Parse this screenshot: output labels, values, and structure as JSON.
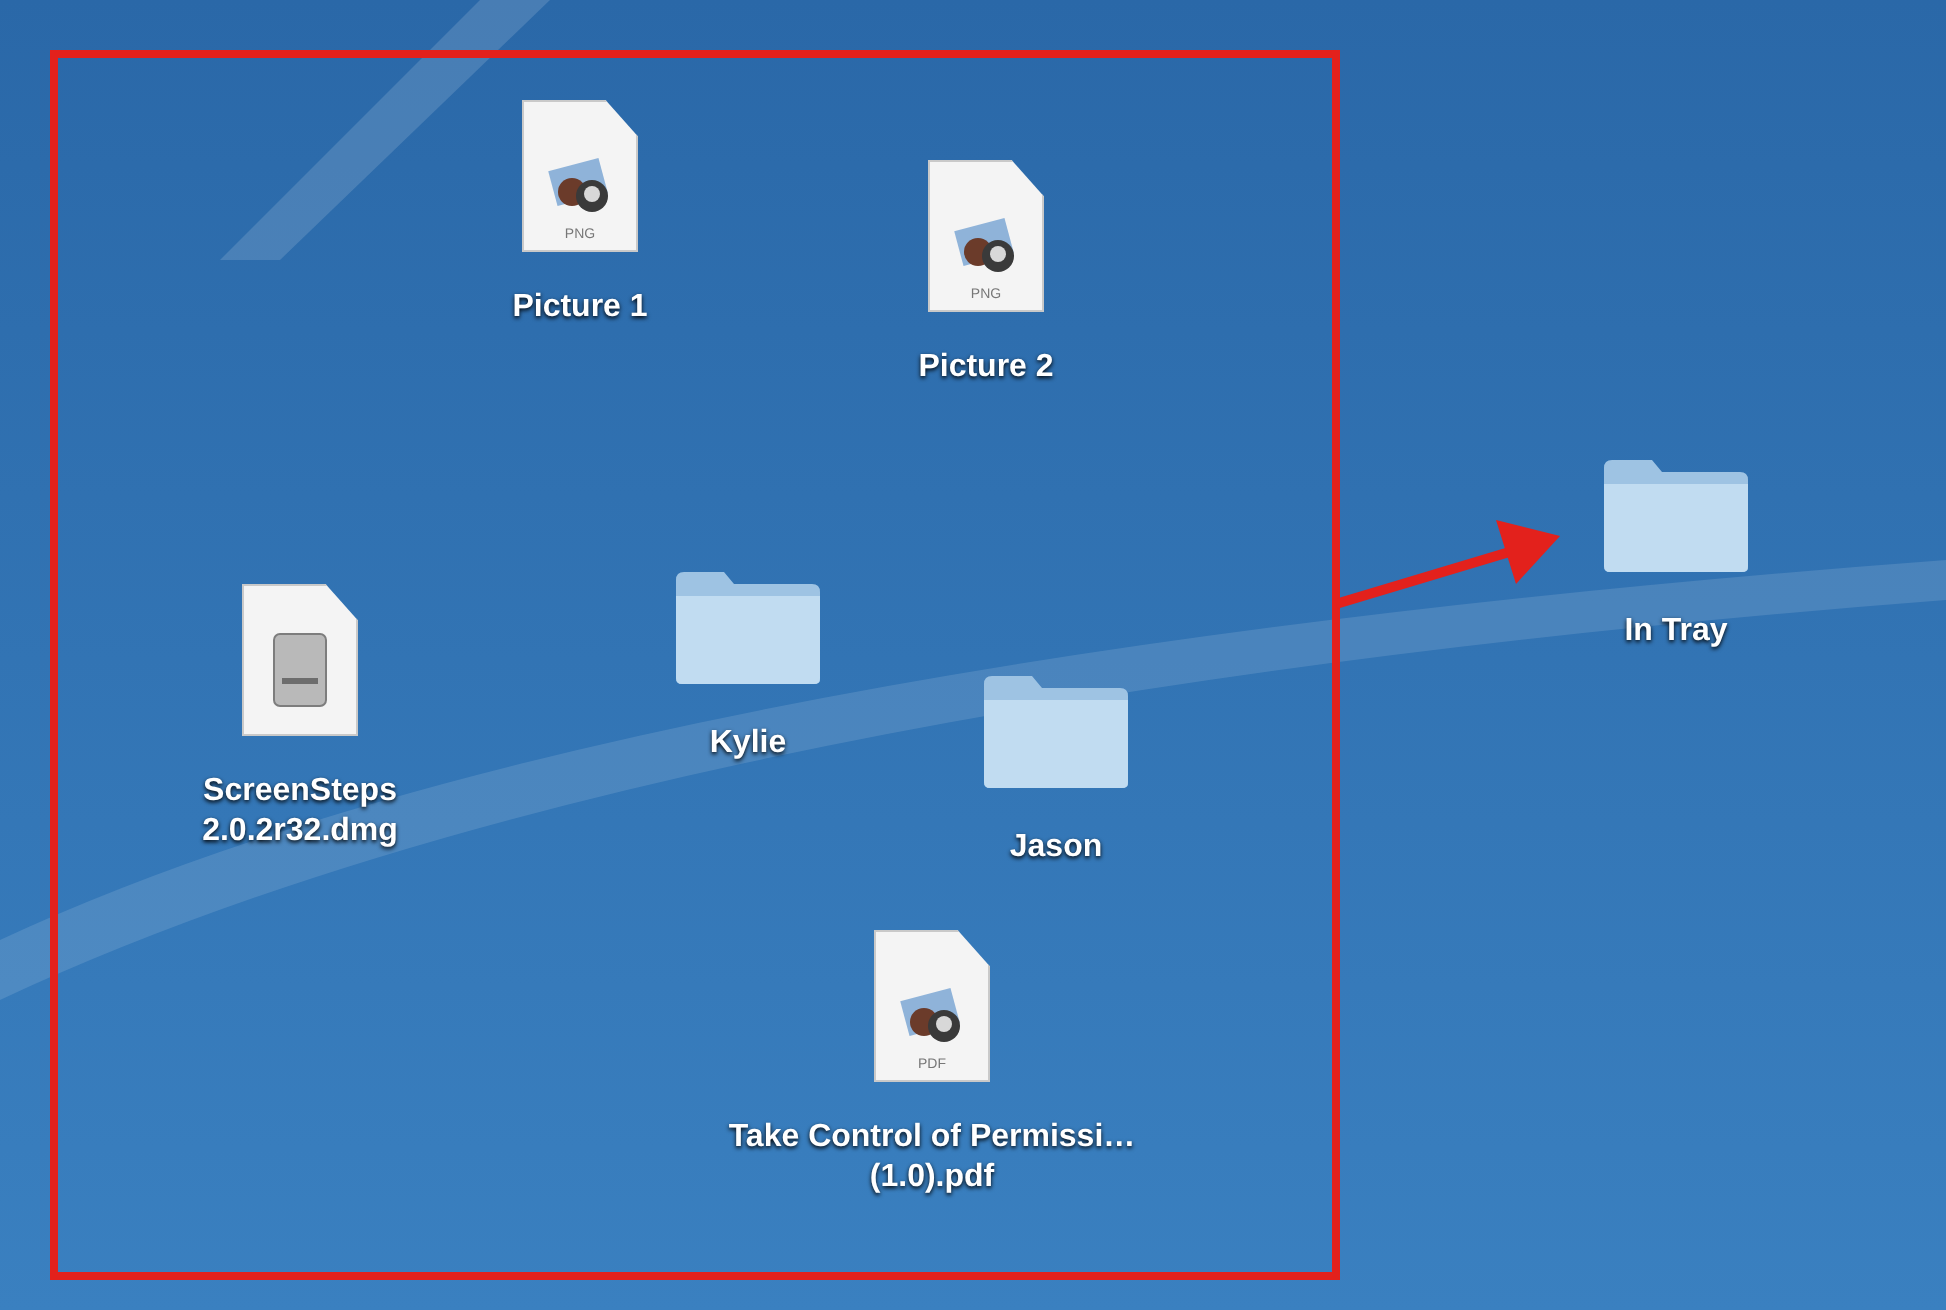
{
  "desktop": {
    "icons": [
      {
        "kind": "image",
        "label": "Picture 1",
        "file_type": "PNG"
      },
      {
        "kind": "image",
        "label": "Picture 2",
        "file_type": "PNG"
      },
      {
        "kind": "disk_image",
        "label": "ScreenSteps 2.0.2r32.dmg"
      },
      {
        "kind": "folder",
        "label": "Kylie"
      },
      {
        "kind": "folder",
        "label": "Jason"
      },
      {
        "kind": "image",
        "label": "Take Control of Permissi… (1.0).pdf",
        "file_type": "PDF"
      },
      {
        "kind": "folder",
        "label": "In Tray"
      }
    ]
  }
}
